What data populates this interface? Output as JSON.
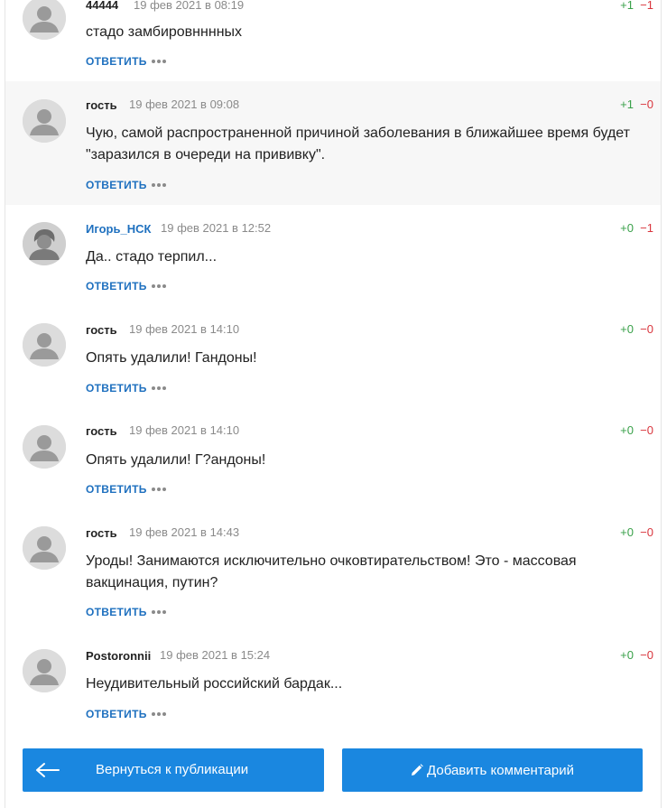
{
  "comments": [
    {
      "author": "44444",
      "date": "19 фев 2021 в 08:19",
      "up": "+1",
      "down": "−1",
      "text": "стадо замбировнннных",
      "reply": "ОТВЕТИТЬ"
    },
    {
      "author": "гость",
      "date": "19 фев 2021 в 09:08",
      "up": "+1",
      "down": "−0",
      "text": "Чую, самой распространенной причиной заболевания в ближайшее время будет \"заразился в очереди на прививку\".",
      "reply": "ОТВЕТИТЬ"
    },
    {
      "author": "Игорь_НСК",
      "date": "19 фев 2021 в 12:52",
      "up": "+0",
      "down": "−1",
      "text": "Да.. стадо терпил...",
      "reply": "ОТВЕТИТЬ"
    },
    {
      "author": "гость",
      "date": "19 фев 2021 в 14:10",
      "up": "+0",
      "down": "−0",
      "text": "Опять удалили! Гандоны!",
      "reply": "ОТВЕТИТЬ"
    },
    {
      "author": "гость",
      "date": "19 фев 2021 в 14:10",
      "up": "+0",
      "down": "−0",
      "text": "Опять удалили! Г?андоны!",
      "reply": "ОТВЕТИТЬ"
    },
    {
      "author": "гость",
      "date": "19 фев 2021 в 14:43",
      "up": "+0",
      "down": "−0",
      "text": "Уроды! Занимаются исключительно очковтирательством! Это - массовая вакцинация, путин?",
      "reply": "ОТВЕТИТЬ"
    },
    {
      "author": "Postoronnii",
      "date": "19 фев 2021 в 15:24",
      "up": "+0",
      "down": "−0",
      "text": "Неудивительный российский бардак...",
      "reply": "ОТВЕТИТЬ"
    }
  ],
  "buttons": {
    "back": "Вернуться к публикации",
    "add": "Добавить комментарий"
  },
  "colors": {
    "accent": "#1a87e0",
    "link": "#1e70bf",
    "vote_up": "#3aa14a",
    "vote_down": "#d9363e"
  },
  "icons": {
    "back": "arrow-left-icon",
    "add": "pencil-icon",
    "avatar": "user-silhouette-icon",
    "more": "more-dots-icon"
  }
}
